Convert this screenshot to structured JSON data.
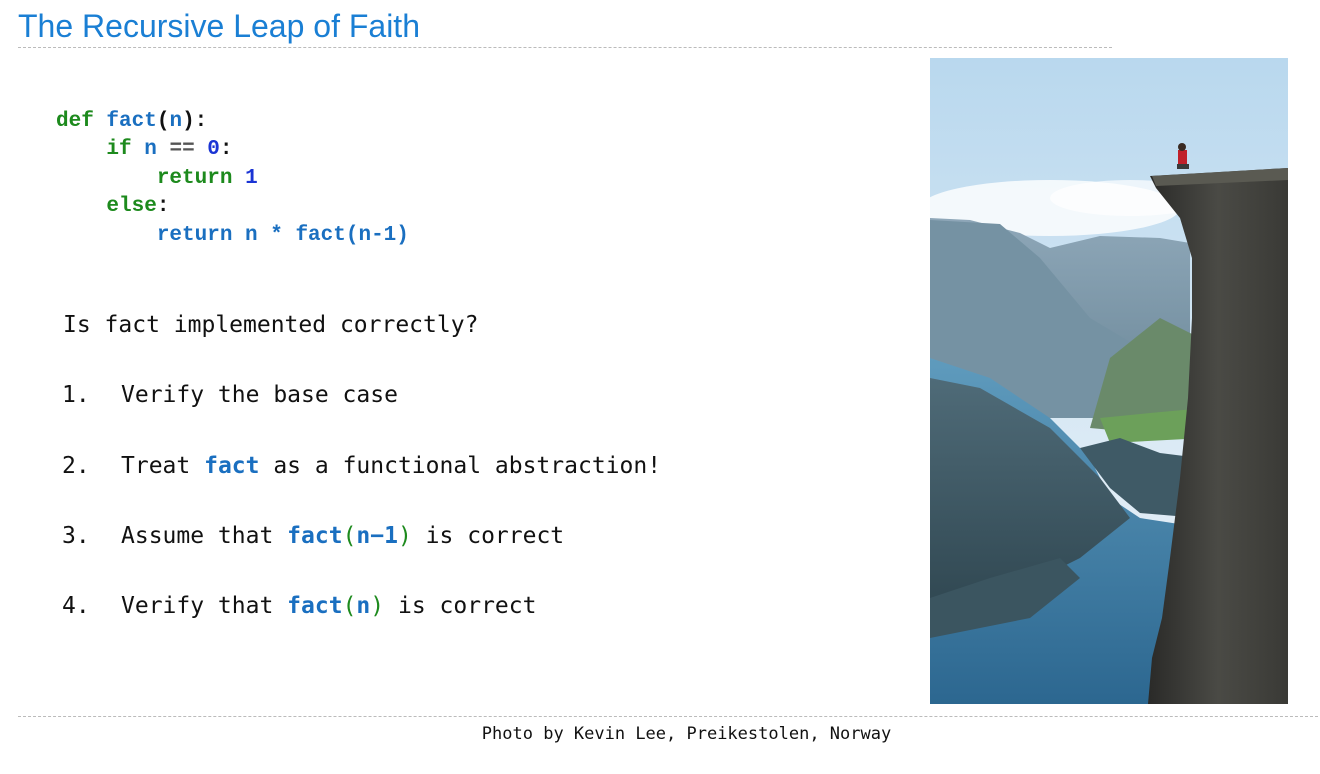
{
  "slide": {
    "title": "The Recursive Leap of Faith",
    "code": {
      "l1_def": "def",
      "l1_name": "fact",
      "l1_open": "(",
      "l1_param": "n",
      "l1_close": "):",
      "l2_if": "if",
      "l2_var": "n",
      "l2_op": "==",
      "l2_zero": "0",
      "l2_colon": ":",
      "l3_return": "return",
      "l3_one": "1",
      "l4_else": "else",
      "l4_colon": ":",
      "l5_expr": "return n * fact(n-1)"
    },
    "question": "Is fact implemented correctly?",
    "steps": [
      {
        "number": "1.",
        "text": "Verify the base case"
      },
      {
        "number": "2.",
        "pre": "Treat ",
        "code": "fact",
        "post": " as a functional abstraction!"
      },
      {
        "number": "3.",
        "pre": "Assume that ",
        "fn": "fact",
        "open": "(",
        "arg": "n−1",
        "close": ")",
        "post": " is correct"
      },
      {
        "number": "4.",
        "pre": "Verify that ",
        "fn": "fact",
        "open": "(",
        "arg": "n",
        "close": ")",
        "post": " is correct"
      }
    ],
    "caption": "Photo by Kevin Lee, Preikestolen, Norway"
  }
}
